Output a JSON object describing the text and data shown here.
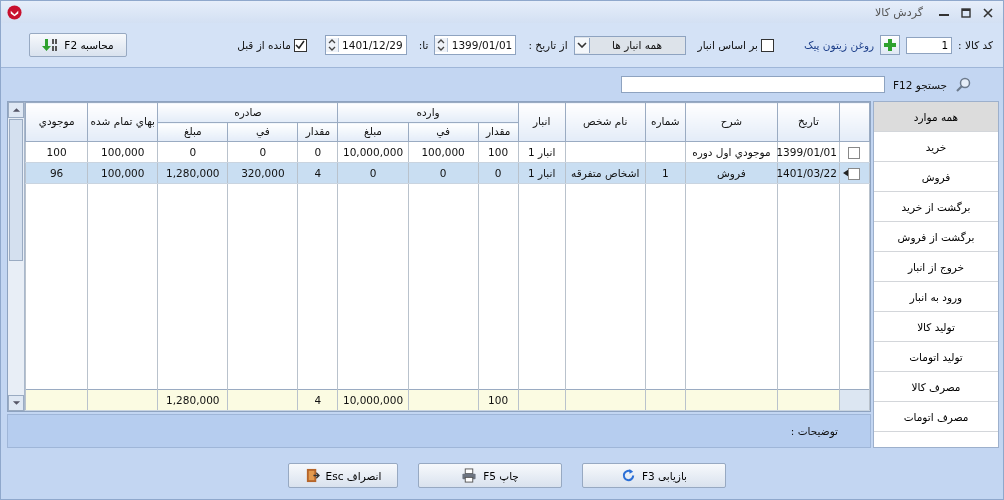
{
  "window": {
    "title": "گردش کالا"
  },
  "toolbar": {
    "item_code_label": "کد کالا :",
    "item_code": "1",
    "item_name": "روغن زیتون پیک",
    "by_warehouse": {
      "label": "بر اساس انبار",
      "checked": false
    },
    "warehouse": {
      "value": "همه انبار ها"
    },
    "from_label": "از تاریخ :",
    "from_date": "1399/01/01",
    "to_label": "تا:",
    "to_date": "1401/12/29",
    "carry_over": {
      "label": "مانده از قبل",
      "checked": true
    },
    "calc_button": "محاسبه F2"
  },
  "search": {
    "label": "جستجو F12"
  },
  "table": {
    "columns": [
      {
        "kind": "checkbox"
      },
      {
        "label": "تاریخ"
      },
      {
        "label": "شرح"
      },
      {
        "label": "شماره"
      },
      {
        "label": "نام شخص"
      },
      {
        "label": "انبار"
      },
      {
        "label": "وارده",
        "children": [
          {
            "label": "مقدار"
          },
          {
            "label": "في"
          },
          {
            "label": "مبلغ"
          }
        ]
      },
      {
        "label": "صادره",
        "children": [
          {
            "label": "مقدار"
          },
          {
            "label": "في"
          },
          {
            "label": "مبلغ"
          }
        ]
      },
      {
        "label": "بهاي تمام شده"
      },
      {
        "label": "موجودي"
      }
    ],
    "rows": [
      {
        "checked": false,
        "selected": false,
        "cells": {
          "date": "1399/01/01",
          "description": "موجودي اول دوره",
          "warehouse": "انبار 1",
          "in_qty": "100",
          "in_price": "100,000",
          "in_amount": "10,000,000",
          "out_qty": "0",
          "out_price": "0",
          "out_amount": "0",
          "cost": "100,000",
          "stock": "100"
        }
      },
      {
        "checked": false,
        "selected": true,
        "cells": {
          "date": "1401/03/22",
          "description": "فروش",
          "number": "1",
          "person": "اشخاص متفرقه",
          "warehouse": "انبار 1",
          "in_qty": "0",
          "in_price": "0",
          "in_amount": "0",
          "out_qty": "4",
          "out_price": "320,000",
          "out_amount": "1,280,000",
          "cost": "100,000",
          "stock": "96"
        }
      }
    ],
    "totals": {
      "in_qty": "100",
      "in_amount": "10,000,000",
      "out_qty": "4",
      "out_amount": "1,280,000"
    }
  },
  "filters": [
    {
      "label": "همه موارد",
      "selected": true
    },
    {
      "label": "خرید",
      "selected": false
    },
    {
      "label": "فروش",
      "selected": false
    },
    {
      "label": "برگشت از خرید",
      "selected": false
    },
    {
      "label": "برگشت از فروش",
      "selected": false
    },
    {
      "label": "خروج از انبار",
      "selected": false
    },
    {
      "label": "ورود به انبار",
      "selected": false
    },
    {
      "label": "تولید کالا",
      "selected": false
    },
    {
      "label": "تولید اتومات",
      "selected": false
    },
    {
      "label": "مصرف کالا",
      "selected": false
    },
    {
      "label": "مصرف اتومات",
      "selected": false
    }
  ],
  "notes": {
    "label": "توضیحات :"
  },
  "buttons": [
    {
      "kind": "refresh",
      "label": "بازیابی F3"
    },
    {
      "kind": "print",
      "label": "چاپ F5"
    },
    {
      "kind": "exit",
      "label": "انصراف Esc"
    }
  ]
}
